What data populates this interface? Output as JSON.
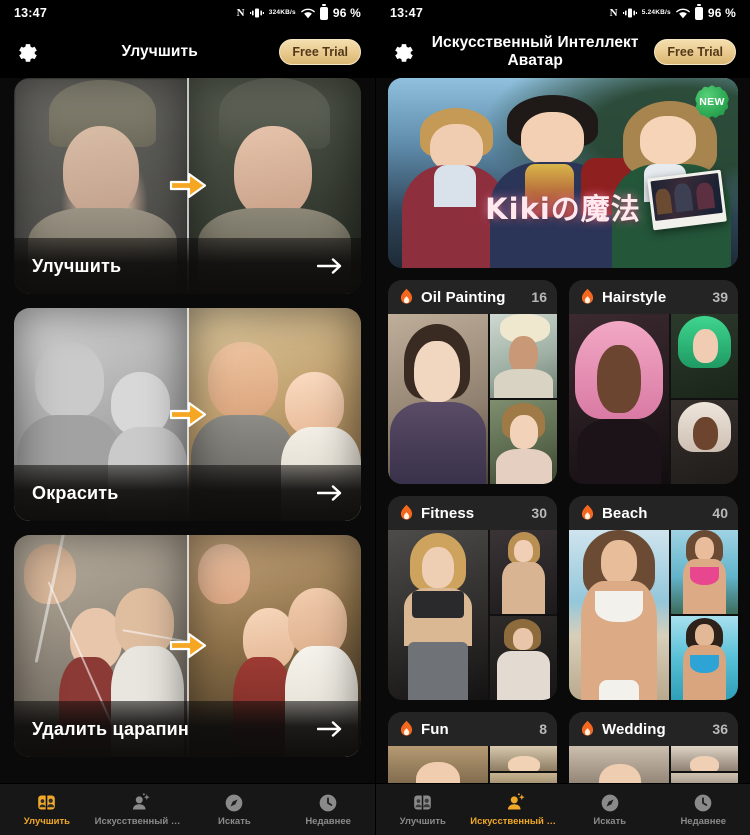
{
  "screens": [
    {
      "id": "enhance-screen",
      "statusbar": {
        "time": "13:47",
        "nfc": "N",
        "netspeed_value": "324",
        "netspeed_unit": "KB/s",
        "battery": "96 %"
      },
      "header": {
        "title": "Улучшить",
        "settings_icon": "gear-icon",
        "trial_label": "Free Trial"
      },
      "cards": [
        {
          "label": "Улучшить",
          "arrow": "arrow-right-icon"
        },
        {
          "label": "Окрасить",
          "arrow": "arrow-right-icon"
        },
        {
          "label": "Удалить царапин",
          "arrow": "arrow-right-icon"
        }
      ],
      "tabs": [
        {
          "label": "Улучшить",
          "icon": "enhance-icon",
          "active": true
        },
        {
          "label": "Искусственный Инт...",
          "icon": "ai-avatar-icon",
          "active": false
        },
        {
          "label": "Искать",
          "icon": "compass-icon",
          "active": false
        },
        {
          "label": "Недавнее",
          "icon": "clock-icon",
          "active": false
        }
      ]
    },
    {
      "id": "ai-avatar-screen",
      "statusbar": {
        "time": "13:47",
        "nfc": "N",
        "netspeed_value": "5.24",
        "netspeed_unit": "KB/s",
        "battery": "96 %"
      },
      "header": {
        "title": "Искусственный Интеллект Аватар",
        "settings_icon": "gear-icon",
        "trial_label": "Free Trial"
      },
      "hero": {
        "title": "Kikiの魔法",
        "badge": "NEW"
      },
      "categories": [
        {
          "name": "Oil Painting",
          "count": "16",
          "icon": "flame-icon"
        },
        {
          "name": "Hairstyle",
          "count": "39",
          "icon": "flame-icon"
        },
        {
          "name": "Fitness",
          "count": "30",
          "icon": "flame-icon"
        },
        {
          "name": "Beach",
          "count": "40",
          "icon": "flame-icon"
        },
        {
          "name": "Fun",
          "count": "8",
          "icon": "flame-icon"
        },
        {
          "name": "Wedding",
          "count": "36",
          "icon": "flame-icon"
        }
      ],
      "tabs": [
        {
          "label": "Улучшить",
          "icon": "enhance-icon",
          "active": false
        },
        {
          "label": "Искусственный Инт...",
          "icon": "ai-avatar-icon",
          "active": true
        },
        {
          "label": "Искать",
          "icon": "compass-icon",
          "active": false
        },
        {
          "label": "Недавнее",
          "icon": "clock-icon",
          "active": false
        }
      ]
    }
  ],
  "colors": {
    "accent": "#f0a828",
    "trial_bg": "#e8c98c",
    "trial_text": "#53391a",
    "badge_green": "#2fab55",
    "tab_inactive": "#8a8a8a",
    "card_bg": "#1b1b1b",
    "screen_bg": "#0a0a0a"
  }
}
